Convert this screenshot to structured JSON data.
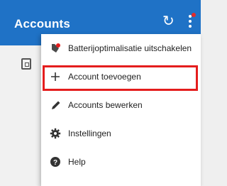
{
  "appbar": {
    "title": "Accounts"
  },
  "menu": {
    "items": [
      {
        "label": "Batterijoptimalisatie uitschakelen",
        "icon": "battery-optimization-icon"
      },
      {
        "label": "Account toevoegen",
        "icon": "plus-icon"
      },
      {
        "label": "Accounts bewerken",
        "icon": "pencil-icon"
      },
      {
        "label": "Instellingen",
        "icon": "gear-icon"
      },
      {
        "label": "Help",
        "icon": "help-icon"
      }
    ]
  },
  "colors": {
    "appbar": "#1f72c6",
    "highlight": "#e41d1d",
    "badge": "#e22b2b"
  }
}
